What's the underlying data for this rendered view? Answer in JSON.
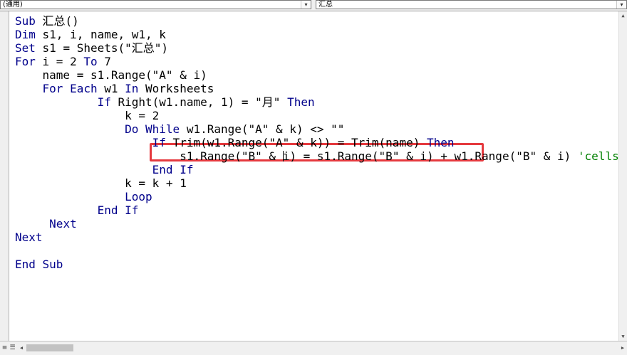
{
  "toolbar": {
    "object_combo": "(通用)",
    "procedure_combo": "汇总",
    "dropdown_glyph": "▾"
  },
  "code_lines": [
    {
      "parts": [
        {
          "k": 1,
          "t": "Sub"
        },
        {
          "k": 0,
          "t": " 汇总()"
        }
      ]
    },
    {
      "parts": [
        {
          "k": 1,
          "t": "Dim"
        },
        {
          "k": 0,
          "t": " s1, i, name, w1, k"
        }
      ]
    },
    {
      "parts": [
        {
          "k": 1,
          "t": "Set"
        },
        {
          "k": 0,
          "t": " s1 = Sheets(\"汇总\")"
        }
      ]
    },
    {
      "parts": [
        {
          "k": 1,
          "t": "For"
        },
        {
          "k": 0,
          "t": " i = 2 "
        },
        {
          "k": 1,
          "t": "To"
        },
        {
          "k": 0,
          "t": " 7"
        }
      ]
    },
    {
      "parts": [
        {
          "k": 0,
          "t": "    name = s1.Range(\"A\" & i)"
        }
      ]
    },
    {
      "parts": [
        {
          "k": 0,
          "t": "    "
        },
        {
          "k": 1,
          "t": "For Each"
        },
        {
          "k": 0,
          "t": " w1 "
        },
        {
          "k": 1,
          "t": "In"
        },
        {
          "k": 0,
          "t": " Worksheets"
        }
      ]
    },
    {
      "parts": [
        {
          "k": 0,
          "t": "            "
        },
        {
          "k": 1,
          "t": "If"
        },
        {
          "k": 0,
          "t": " Right(w1.name, 1) = \"月\" "
        },
        {
          "k": 1,
          "t": "Then"
        }
      ]
    },
    {
      "parts": [
        {
          "k": 0,
          "t": "                k = 2"
        }
      ]
    },
    {
      "parts": [
        {
          "k": 0,
          "t": "                "
        },
        {
          "k": 1,
          "t": "Do While"
        },
        {
          "k": 0,
          "t": " w1.Range(\"A\" & k) <> \"\""
        }
      ]
    },
    {
      "parts": [
        {
          "k": 0,
          "t": "                    "
        },
        {
          "k": 1,
          "t": "If"
        },
        {
          "k": 0,
          "t": " Trim(w1.Range(\"A\" & k)) = Trim(name) "
        },
        {
          "k": 1,
          "t": "Then"
        }
      ]
    },
    {
      "parts": [
        {
          "k": 0,
          "t": "                        s1.Range(\"B\" & "
        },
        {
          "k": 3,
          "t": ""
        },
        {
          "k": 0,
          "t": "i) = s1.Range(\"B\" & i) + w1.Range(\"B\" & i) "
        },
        {
          "k": 2,
          "t": "'cells(i,"
        }
      ]
    },
    {
      "parts": [
        {
          "k": 0,
          "t": "                    "
        },
        {
          "k": 1,
          "t": "End If"
        }
      ]
    },
    {
      "parts": [
        {
          "k": 0,
          "t": "                k = k + 1"
        }
      ]
    },
    {
      "parts": [
        {
          "k": 0,
          "t": "                "
        },
        {
          "k": 1,
          "t": "Loop"
        }
      ]
    },
    {
      "parts": [
        {
          "k": 0,
          "t": "            "
        },
        {
          "k": 1,
          "t": "End If"
        }
      ]
    },
    {
      "parts": [
        {
          "k": 0,
          "t": "     "
        },
        {
          "k": 1,
          "t": "Next"
        }
      ]
    },
    {
      "parts": [
        {
          "k": 1,
          "t": "Next"
        }
      ]
    },
    {
      "parts": []
    },
    {
      "parts": [
        {
          "k": 1,
          "t": "End Sub"
        }
      ]
    }
  ],
  "colors": {
    "keyword": "#00008b",
    "comment": "#008000",
    "highlight_box": "#e5393e"
  },
  "icons": {
    "scroll_up": "▲",
    "scroll_down": "▼",
    "scroll_left": "◀",
    "scroll_right": "▶",
    "procedure_view": "≡",
    "module_view": "☰"
  }
}
